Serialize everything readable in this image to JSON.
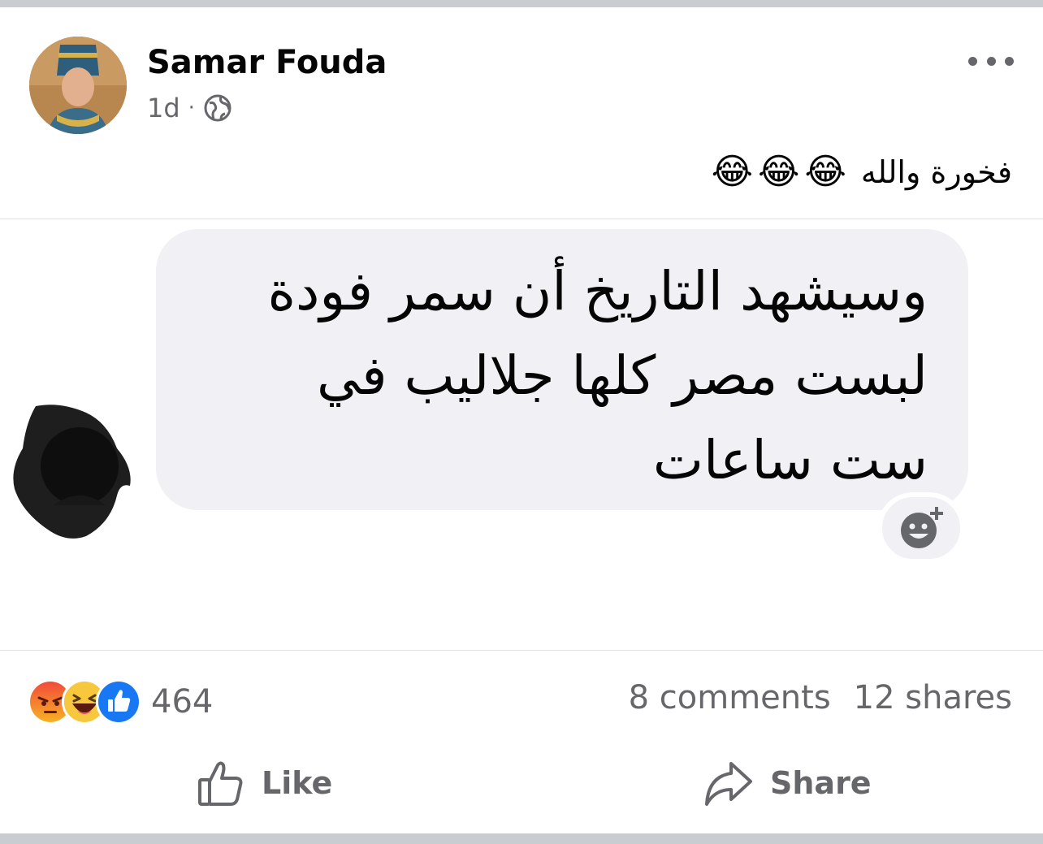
{
  "post": {
    "author": "Samar Fouda",
    "time": "1d",
    "separator": "·",
    "privacy_icon": "globe-icon",
    "more_icon": "more-options-icon",
    "caption": "فخورة والله",
    "caption_emojis": [
      "😂",
      "😂",
      "😂"
    ]
  },
  "comment_image": {
    "lines": [
      "وسيشهد التاريخ أن سمر فودة",
      "لبست مصر كلها جلاليب في",
      "ست ساعات"
    ],
    "add_reaction_icon": "add-reaction-icon"
  },
  "engagement": {
    "reaction_icons": [
      "angry",
      "haha",
      "like"
    ],
    "reaction_count": "464",
    "comments": "8 comments",
    "shares": "12 shares"
  },
  "actions": {
    "like_label": "Like",
    "share_label": "Share"
  },
  "colors": {
    "secondary_text": "#65676b",
    "bubble_bg": "#f0f0f5",
    "like_blue": "#1877f2",
    "angry_red": "#e9710f",
    "haha_yellow": "#f7b125"
  }
}
